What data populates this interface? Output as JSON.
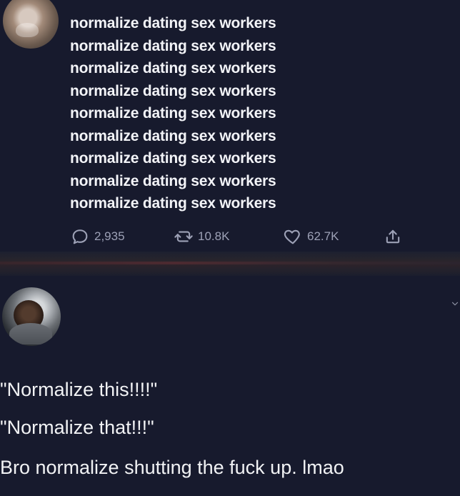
{
  "tweet": {
    "lines": [
      "normalize dating sex workers",
      "normalize dating sex workers",
      "normalize dating sex workers",
      "normalize dating sex workers",
      "normalize dating sex workers",
      "normalize dating sex workers",
      "normalize dating sex workers",
      "normalize dating sex workers",
      "normalize dating sex workers"
    ],
    "actions": {
      "reply_count": "2,935",
      "retweet_count": "10.8K",
      "like_count": "62.7K"
    }
  },
  "post": {
    "lines": [
      "\"Normalize this!!!!\"",
      "\"Normalize that!!!\"",
      "Bro normalize shutting the fuck up. lmao"
    ]
  },
  "icons": {
    "reply": "reply-icon",
    "retweet": "retweet-icon",
    "like": "heart-icon",
    "share": "share-icon",
    "more": "chevron-down-icon"
  },
  "colors": {
    "background": "#171a2d",
    "text_primary": "#f3f4f8",
    "text_secondary": "#9da1b6"
  }
}
